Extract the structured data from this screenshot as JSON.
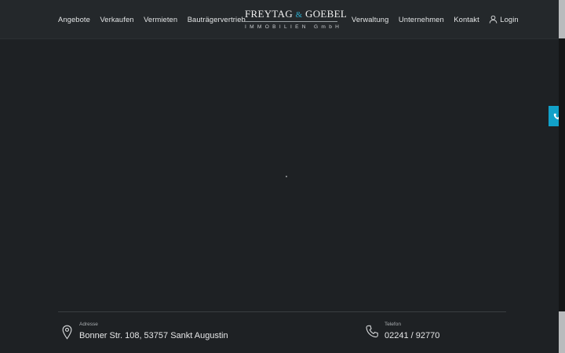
{
  "nav": {
    "left": [
      {
        "label": "Angebote"
      },
      {
        "label": "Verkaufen"
      },
      {
        "label": "Vermieten"
      },
      {
        "label": "Bauträgervertrieb"
      }
    ],
    "right": [
      {
        "label": "Verwaltung"
      },
      {
        "label": "Unternehmen"
      },
      {
        "label": "Kontakt"
      }
    ],
    "login_label": "Login",
    "login_icon": "user-icon"
  },
  "logo": {
    "name_part1": "FREYTAG",
    "ampersand": "&",
    "name_part2": "GOEBEL",
    "subtitle": "IMMOBILIEN GmbH",
    "accent_color": "#2aa8c8"
  },
  "side_tab": {
    "icon": "phone-icon",
    "color": "#12a1c9"
  },
  "footer": {
    "address": {
      "label": "Adresse",
      "value": "Bonner Str. 108, 53757 Sankt Augustin",
      "icon": "location-pin-icon"
    },
    "phone": {
      "label": "Telefon",
      "value": "02241 / 92770",
      "icon": "phone-icon"
    }
  },
  "colors": {
    "background": "#1e2124",
    "header": "#24282b"
  }
}
